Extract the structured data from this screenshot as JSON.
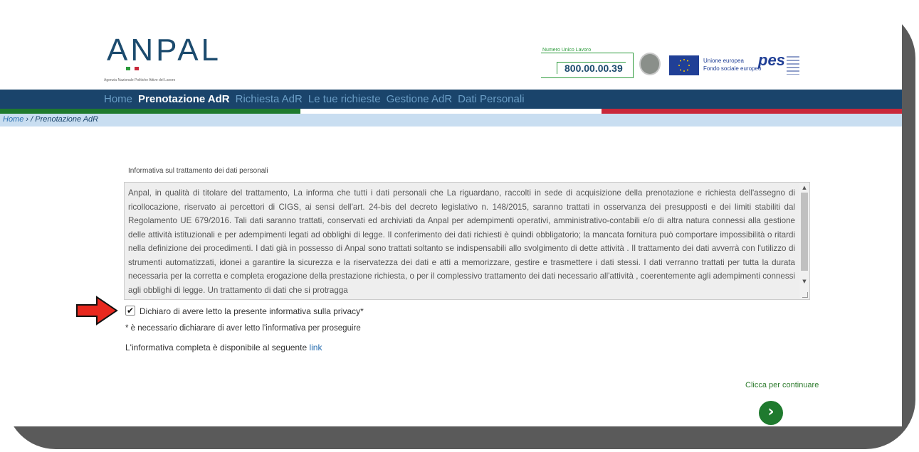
{
  "header": {
    "logo_text": "ANPAL",
    "logo_subtitle": "Agenzia Nazionale Politiche Attive del Lavoro",
    "numero_label": "Numero Unico Lavoro",
    "numero_value": "800.00.00.39",
    "eu_line1": "Unione europea",
    "eu_line2": "Fondo sociale europeo",
    "pes_logo": "pes"
  },
  "nav": {
    "items": [
      {
        "label": "Home"
      },
      {
        "label": "Prenotazione AdR",
        "active": true
      },
      {
        "label": "Richiesta AdR"
      },
      {
        "label": "Le tue richieste"
      },
      {
        "label": "Gestione AdR"
      },
      {
        "label": "Dati Personali"
      }
    ]
  },
  "breadcrumb": {
    "home": "Home",
    "separator": "›",
    "current": "/ Prenotazione AdR"
  },
  "informativa": {
    "title": "Informativa sul trattamento dei dati personali",
    "text": "Anpal, in qualità  di titolare del trattamento, La informa che tutti i dati personali che La riguardano, raccolti in sede di acquisizione della prenotazione e richiesta dell'assegno di ricollocazione, riservato ai percettori di CIGS, ai sensi dell'art. 24-bis del decreto legislativo n. 148/2015, saranno trattati in osservanza dei presupposti e dei limiti stabiliti dal Regolamento UE 679/2016. Tali dati saranno trattati, conservati ed archiviati da Anpal per adempimenti operativi, amministrativo-contabili e/o di altra natura connessi alla gestione delle attività  istituzionali e per adempimenti legati ad obblighi di legge. Il conferimento dei dati richiesti è quindi obbligatorio; la mancata fornitura può comportare impossibilità  o ritardi nella definizione dei procedimenti. I dati già  in possesso di Anpal sono trattati soltanto se indispensabili allo svolgimento di dette attività . Il trattamento dei dati avverrà  con l'utilizzo di strumenti automatizzati, idonei a garantire la sicurezza e la riservatezza dei dati e atti a memorizzare, gestire e trasmettere i dati stessi. I dati verranno trattati per tutta la durata necessaria per la corretta e completa erogazione della prestazione richiesta, o per il complessivo trattamento dei dati necessario all'attività , coerentemente agli adempimenti connessi agli obblighi di legge. Un trattamento di dati che si protragga"
  },
  "consent": {
    "checked": true,
    "label": "Dichiaro di avere letto la presente informativa sulla privacy*",
    "note": "* è necessario dichiarare di aver letto l'informativa per proseguire",
    "full_info_prefix": "L'informativa completa è disponibile al seguente",
    "full_info_link": "link"
  },
  "continue": {
    "label": "Clicca per continuare",
    "icon": "chevron-right-icon"
  },
  "colors": {
    "nav_bg": "#1a446b",
    "breadcrumb_bg": "#c9def1",
    "green": "#1f7a2e",
    "red": "#c9283a",
    "arrow_red": "#e8281e"
  }
}
